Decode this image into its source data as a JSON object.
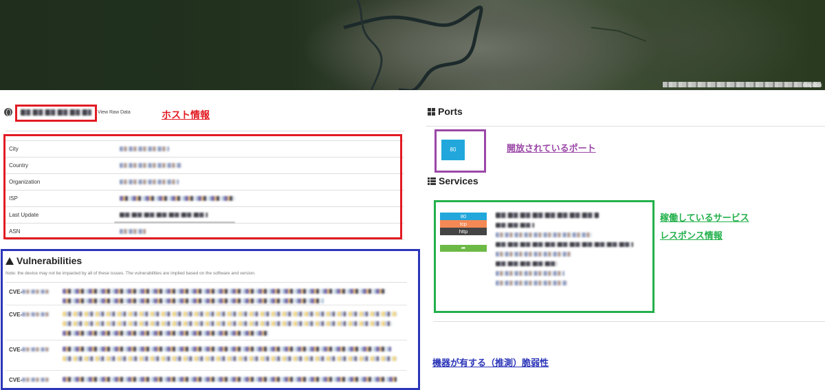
{
  "map": {
    "attribution": "mapbox"
  },
  "host": {
    "view_raw_label": "View Raw Data",
    "annotation": "ホスト情報",
    "rows": [
      {
        "key": "City"
      },
      {
        "key": "Country"
      },
      {
        "key": "Organization"
      },
      {
        "key": "ISP"
      },
      {
        "key": "Last Update"
      },
      {
        "key": "ASN"
      }
    ]
  },
  "vulnerabilities": {
    "title": "Vulnerabilities",
    "note": "Note: the device may not be impacted by all of these issues. The vulnerabilities are implied based on the software and version.",
    "cve_prefix": "CVE-",
    "annotation": "機器が有する（推測）脆弱性"
  },
  "ports": {
    "title": "Ports",
    "items": [
      "80"
    ],
    "annotation": "開放されているポート"
  },
  "services": {
    "title": "Services",
    "port": "80",
    "transport": "tcp",
    "protocol": "http",
    "link_icon": "share-arrow-icon",
    "annotation_running": "稼働しているサービス",
    "annotation_response": "レスポンス情報"
  },
  "colors": {
    "annotation_red": "#e21b23",
    "annotation_purple": "#9a47a6",
    "annotation_green": "#22b04a",
    "annotation_blue": "#2b35b8",
    "port_blue": "#21a7dc",
    "tcp_orange": "#f48955",
    "http_dark": "#444444",
    "link_green": "#6cb945"
  }
}
